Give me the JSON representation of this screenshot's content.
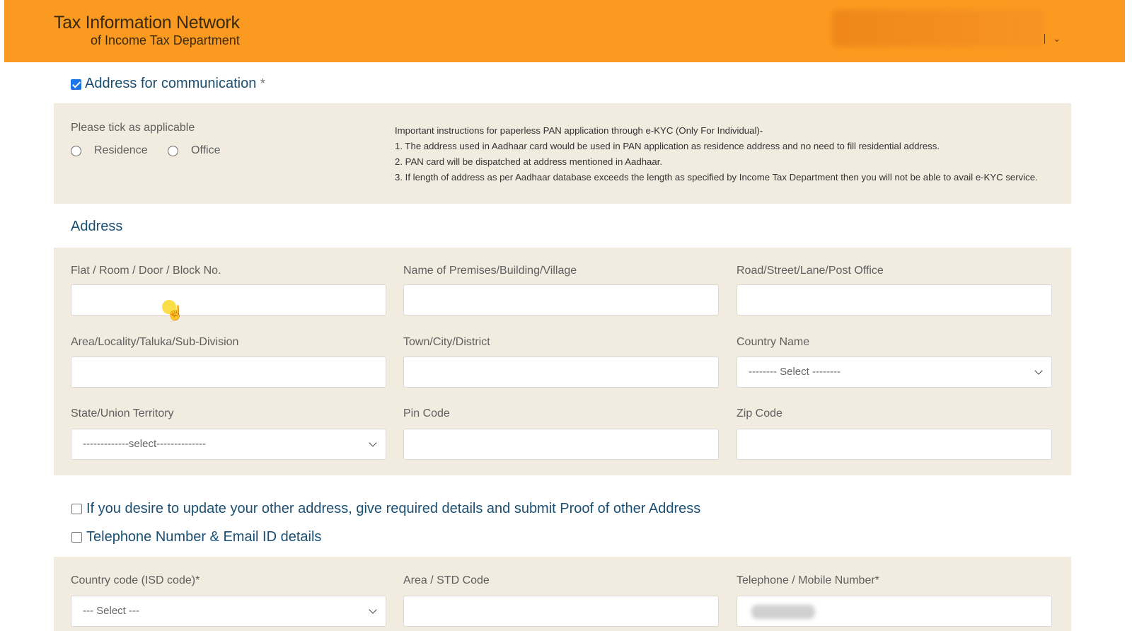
{
  "header": {
    "logo_line1": "Tax Information Network",
    "logo_line2": "of Income Tax Department",
    "user_caret": "⌄"
  },
  "address_for_communication": {
    "label": "Address for communication",
    "required_mark": "*",
    "checked": true
  },
  "tick_panel": {
    "prompt": "Please tick as applicable",
    "options": [
      "Residence",
      "Office"
    ],
    "instructions": [
      "Important instructions for paperless PAN application through e-KYC (Only For Individual)-",
      "1. The address used in Aadhaar card would be used in PAN application as residence address and no need to fill residential address.",
      "2. PAN card will be dispatched at address mentioned in Aadhaar.",
      "3. If length of address as per Aadhaar database exceeds the length as specified by Income Tax Department then you will not be able to avail e-KYC service."
    ]
  },
  "address": {
    "title": "Address",
    "fields": {
      "flat": "Flat / Room / Door / Block No.",
      "premises": "Name of Premises/Building/Village",
      "road": "Road/Street/Lane/Post Office",
      "area": "Area/Locality/Taluka/Sub-Division",
      "town": "Town/City/District",
      "country": "Country Name",
      "state": "State/Union Territory",
      "pin": "Pin Code",
      "zip": "Zip Code"
    },
    "country_select": "-------- Select --------",
    "state_select": "-------------select--------------"
  },
  "other_address": {
    "label": "If you desire to update your other address, give required details and submit Proof of other Address",
    "checked": false
  },
  "telephone_email": {
    "label": "Telephone Number & Email ID details",
    "checked": false,
    "fields": {
      "isd": "Country code (ISD code)*",
      "std": "Area / STD Code",
      "phone": "Telephone / Mobile Number*"
    },
    "isd_select": "--- Select ---"
  }
}
